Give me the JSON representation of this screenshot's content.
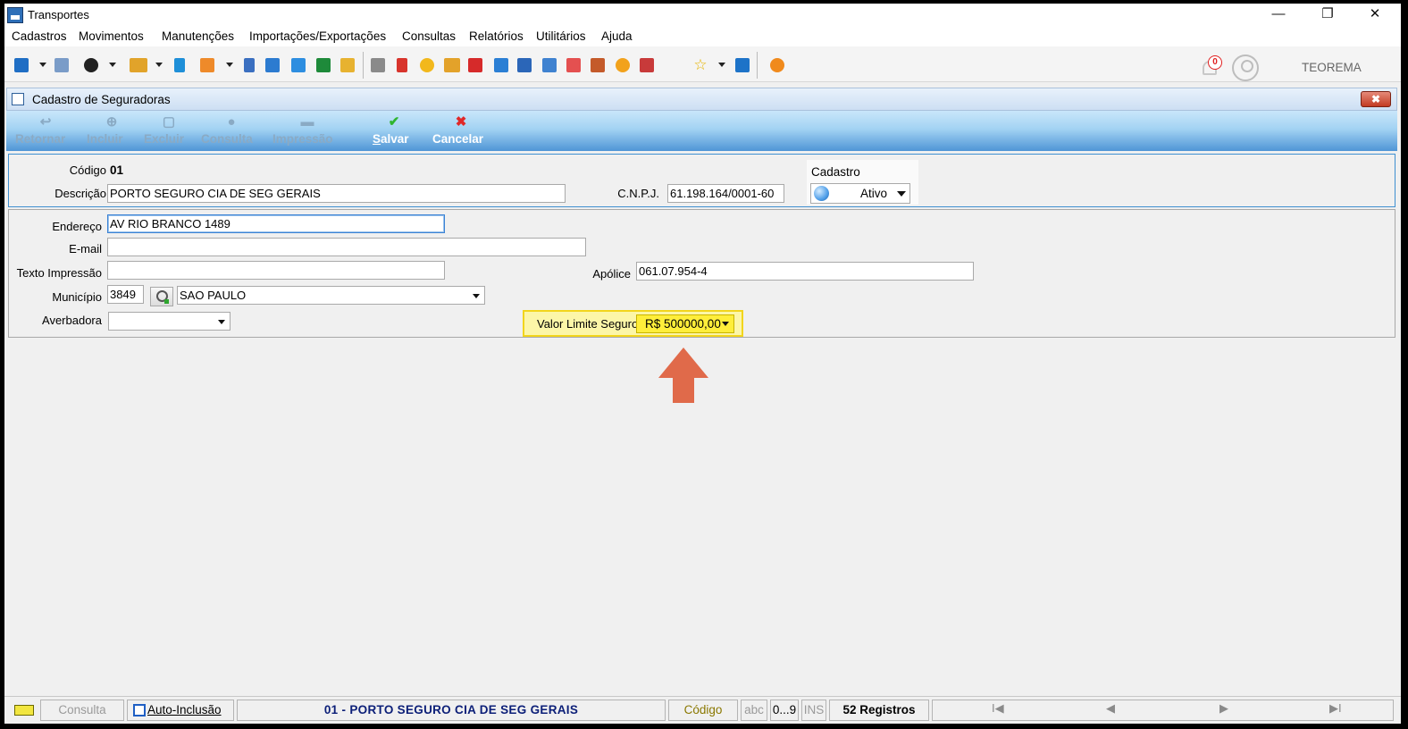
{
  "app": {
    "title": "Transportes",
    "user": "TEOREMA",
    "notifications": "0"
  },
  "window_controls": {
    "minimize": "—",
    "restore": "❐",
    "close": "✕"
  },
  "menu": [
    "Cadastros",
    "Movimentos",
    "Manutenções",
    "Importações/Exportações",
    "Consultas",
    "Relatórios",
    "Utilitários",
    "Ajuda"
  ],
  "child_window": {
    "title": "Cadastro de Seguradoras",
    "close": "✖"
  },
  "actions": {
    "retornar": "Retornar",
    "incluir": "Incluir",
    "excluir": "Excluir",
    "consulta": "Consulta",
    "impressao": "Impressão",
    "salvar_first": "S",
    "salvar_rest": "alvar",
    "cancelar": "Cancelar"
  },
  "form": {
    "codigo_label": "Código",
    "codigo_value": "01",
    "descricao_label": "Descrição",
    "descricao_value": "PORTO SEGURO CIA DE SEG GERAIS",
    "cnpj_label": "C.N.P.J.",
    "cnpj_value": "61.198.164/0001-60",
    "cadastro_label": "Cadastro",
    "cadastro_value": "Ativo",
    "endereco_label": "Endereço",
    "endereco_value": "AV RIO BRANCO 1489",
    "email_label": "E-mail",
    "email_value": "",
    "texto_label": "Texto Impressão",
    "texto_value": "",
    "apolice_label": "Apólice",
    "apolice_value": "061.07.954-4",
    "municipio_label": "Município",
    "municipio_code": "3849",
    "municipio_name": "SAO PAULO",
    "averbadora_label": "Averbadora",
    "averbadora_value": "",
    "valor_label": "Valor Limite Seguro",
    "valor_value": "R$ 500000,00"
  },
  "status": {
    "consulta": "Consulta",
    "auto_inclusao": "Auto-Inclusão",
    "record": "01 - PORTO SEGURO CIA DE SEG GERAIS",
    "ordem": "Código",
    "abc": "abc",
    "num": "0...9",
    "ins": "INS",
    "registros": "52 Registros",
    "first": "I◀",
    "prev": "◀",
    "next": "▶",
    "last": "▶I"
  },
  "colors": {
    "accent_blue": "#3f8fd0",
    "highlight_yellow": "#fcf6a8",
    "arrow_orange": "#e06a4a",
    "record_text": "#0c1f78",
    "ordem_text": "#8a7800"
  }
}
